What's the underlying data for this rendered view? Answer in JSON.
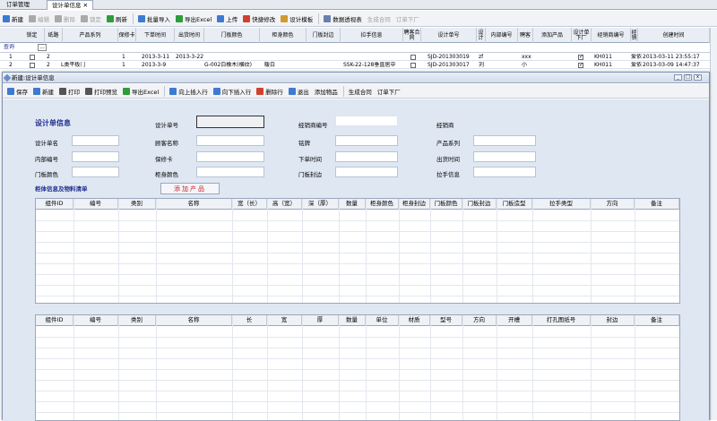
{
  "tabs": [
    {
      "label": "订单管理"
    },
    {
      "label": "设计单信息"
    }
  ],
  "toolbar": [
    {
      "label": "新建",
      "icon": "new-icon",
      "enabled": true
    },
    {
      "label": "编辑",
      "icon": "edit-icon",
      "enabled": false
    },
    {
      "label": "删除",
      "icon": "delete-icon",
      "enabled": false
    },
    {
      "label": "锁定",
      "icon": "lock-icon",
      "enabled": false
    },
    {
      "label": "刷新",
      "icon": "refresh-icon",
      "enabled": true
    },
    {
      "label": "批量导入",
      "icon": "import-icon",
      "enabled": true
    },
    {
      "label": "导出Excel",
      "icon": "excel-icon",
      "enabled": true
    },
    {
      "label": "上传",
      "icon": "upload-icon",
      "enabled": true
    },
    {
      "label": "快捷修改",
      "icon": "quick-edit-icon",
      "enabled": true
    },
    {
      "label": "设计模板",
      "icon": "template-icon",
      "enabled": true
    },
    {
      "label": "数据透视表",
      "icon": "pivot-icon",
      "enabled": true
    },
    {
      "label": "生成合同",
      "icon": "",
      "enabled": false
    },
    {
      "label": "订单下厂",
      "icon": "",
      "enabled": false
    }
  ],
  "grid": {
    "columns": [
      "锁定",
      "纸路",
      "产品系列",
      "保修卡",
      "下单时间",
      "出货时间",
      "门板颜色",
      "柜身颜色",
      "门板封边",
      "拉手信息",
      "聘客合同",
      "设计单号",
      "设计",
      "内部编号",
      "聘客",
      "添加产品",
      "设计单下厂",
      "经销商编号",
      "经销",
      "创建时间"
    ],
    "query_label": "查询",
    "query_btn": "...",
    "rows": [
      {
        "no": "1",
        "a": "2",
        "series": "",
        "card": "1",
        "order": "2013-3-11",
        "ship": "2013-3-22",
        "door": "",
        "body": "",
        "edge": "",
        "handle": "",
        "code": "SJD-201303019",
        "d": "zf",
        "inner": "",
        "cust": "xxx",
        "factory": true,
        "dealer": "KH011",
        "dl": "爱依",
        "created": "2013-03-11 23:55:17"
      },
      {
        "no": "2",
        "a": "2",
        "series": "L类平板门",
        "card": "1",
        "order": "2013-3-9",
        "ship": "",
        "door": "G-002白橡木(横纹)",
        "body": "暖白",
        "edge": "",
        "handle": "SSK-22-128垂直居中",
        "code": "SJD-201303017",
        "d": "刘",
        "inner": "",
        "cust": "小",
        "factory": true,
        "dealer": "KH011",
        "dl": "爱依",
        "created": "2013-03-09 14:47:37"
      }
    ]
  },
  "dialog": {
    "title": "新建:设计单信息",
    "toolbar": [
      {
        "label": "保存",
        "icon": "save-icon"
      },
      {
        "label": "新建",
        "icon": "new-icon"
      },
      {
        "label": "打印",
        "icon": "print-icon"
      },
      {
        "label": "打印预览",
        "icon": "print-preview-icon"
      },
      {
        "label": "导出Excel",
        "icon": "excel-icon"
      },
      {
        "label": "向上插入行",
        "icon": "insert-up-icon"
      },
      {
        "label": "向下插入行",
        "icon": "insert-down-icon"
      },
      {
        "label": "删除行",
        "icon": "delete-row-icon"
      },
      {
        "label": "退出",
        "icon": "exit-icon"
      },
      {
        "label": "添加物品",
        "icon": ""
      },
      {
        "label": "生成合同",
        "icon": ""
      },
      {
        "label": "订单下厂",
        "icon": ""
      }
    ],
    "section_title": "设计单信息",
    "fields": {
      "design_name": "设计单名",
      "inner_no": "内部编号",
      "door_color": "门板颜色",
      "design_no": "设计单号",
      "customer": "顾客名称",
      "warranty": "保修卡",
      "body_color": "柜身颜色",
      "dealer_no": "经销商编号",
      "brand": "铭牌",
      "order_time": "下单时间",
      "door_edge": "门板封边",
      "dealer": "经销商",
      "series": "产品系列",
      "ship_time": "出货时间",
      "handle": "拉手信息"
    },
    "cabinet_title": "柜体信息及物料清单",
    "add_product": "添加产品",
    "table1_cols": [
      "组件ID",
      "编号",
      "类别",
      "名称",
      "宽（长）",
      "高（宽）",
      "深（厚）",
      "数量",
      "柜身颜色",
      "柜身封边",
      "门板颜色",
      "门板封边",
      "门板造型",
      "拉手类型",
      "方向",
      "备注"
    ],
    "table2_cols": [
      "组件ID",
      "编号",
      "类别",
      "名称",
      "长",
      "宽",
      "厚",
      "数量",
      "单位",
      "材质",
      "型号",
      "方向",
      "开槽",
      "打孔图纸号",
      "封边",
      "备注"
    ]
  },
  "colors": {
    "accent": "#1f2d8f",
    "add_btn_text": "#c8191e",
    "form_bg": "#dfe7f2"
  }
}
